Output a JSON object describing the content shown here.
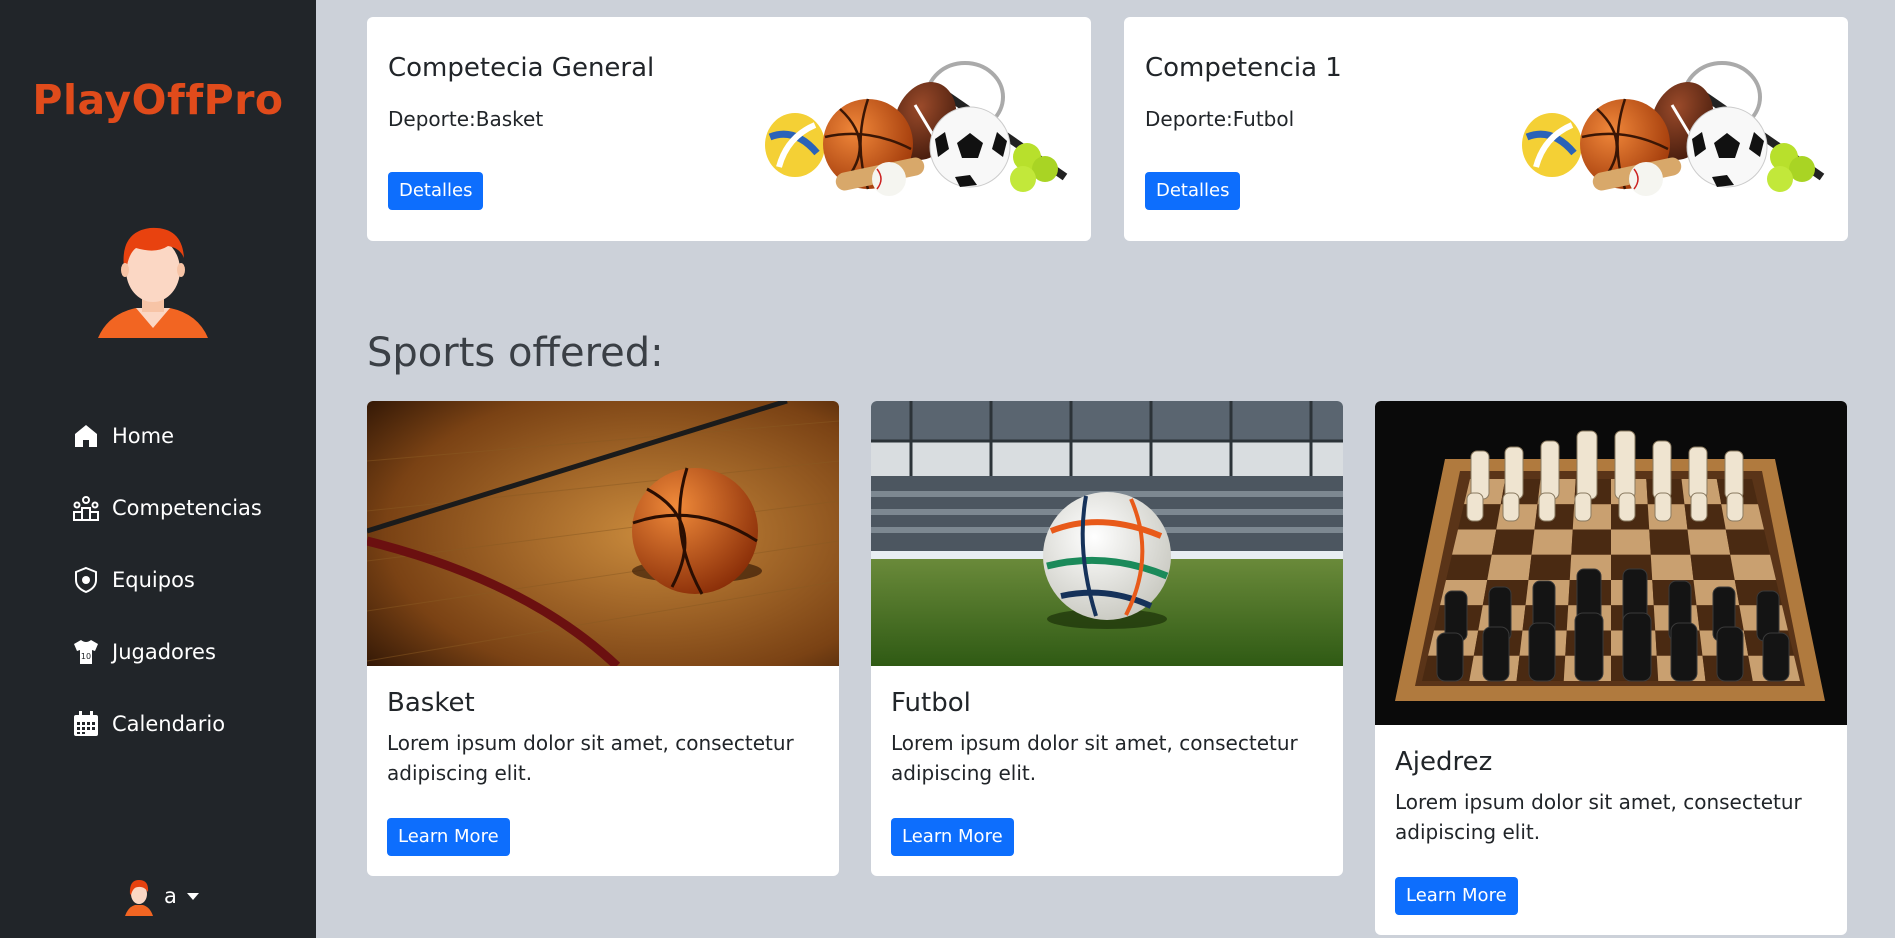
{
  "sidebar": {
    "brand": "PlayOffPro",
    "nav": [
      {
        "label": "Home",
        "icon": "home-icon"
      },
      {
        "label": "Competencias",
        "icon": "podium-icon"
      },
      {
        "label": "Equipos",
        "icon": "shield-icon"
      },
      {
        "label": "Jugadores",
        "icon": "jersey-icon"
      },
      {
        "label": "Calendario",
        "icon": "calendar-icon"
      }
    ],
    "user": {
      "name": "a",
      "icon": "user-avatar-icon"
    }
  },
  "competitions": [
    {
      "title": "Competecia General",
      "sport": "Deporte:Basket",
      "button": "Detalles"
    },
    {
      "title": "Competencia 1",
      "sport": "Deporte:Futbol",
      "button": "Detalles"
    }
  ],
  "sports_section": {
    "title": "Sports offered:",
    "items": [
      {
        "name": "Basket",
        "description": "Lorem ipsum dolor sit amet, consectetur adipiscing elit.",
        "button": "Learn More"
      },
      {
        "name": "Futbol",
        "description": "Lorem ipsum dolor sit amet, consectetur adipiscing elit.",
        "button": "Learn More"
      },
      {
        "name": "Ajedrez",
        "description": "Lorem ipsum dolor sit amet, consectetur adipiscing elit.",
        "button": "Learn More"
      }
    ]
  },
  "colors": {
    "sidebar_bg": "#212529",
    "brand": "#e04b1b",
    "page_bg": "#ccd1d9",
    "primary": "#0d6efd"
  }
}
